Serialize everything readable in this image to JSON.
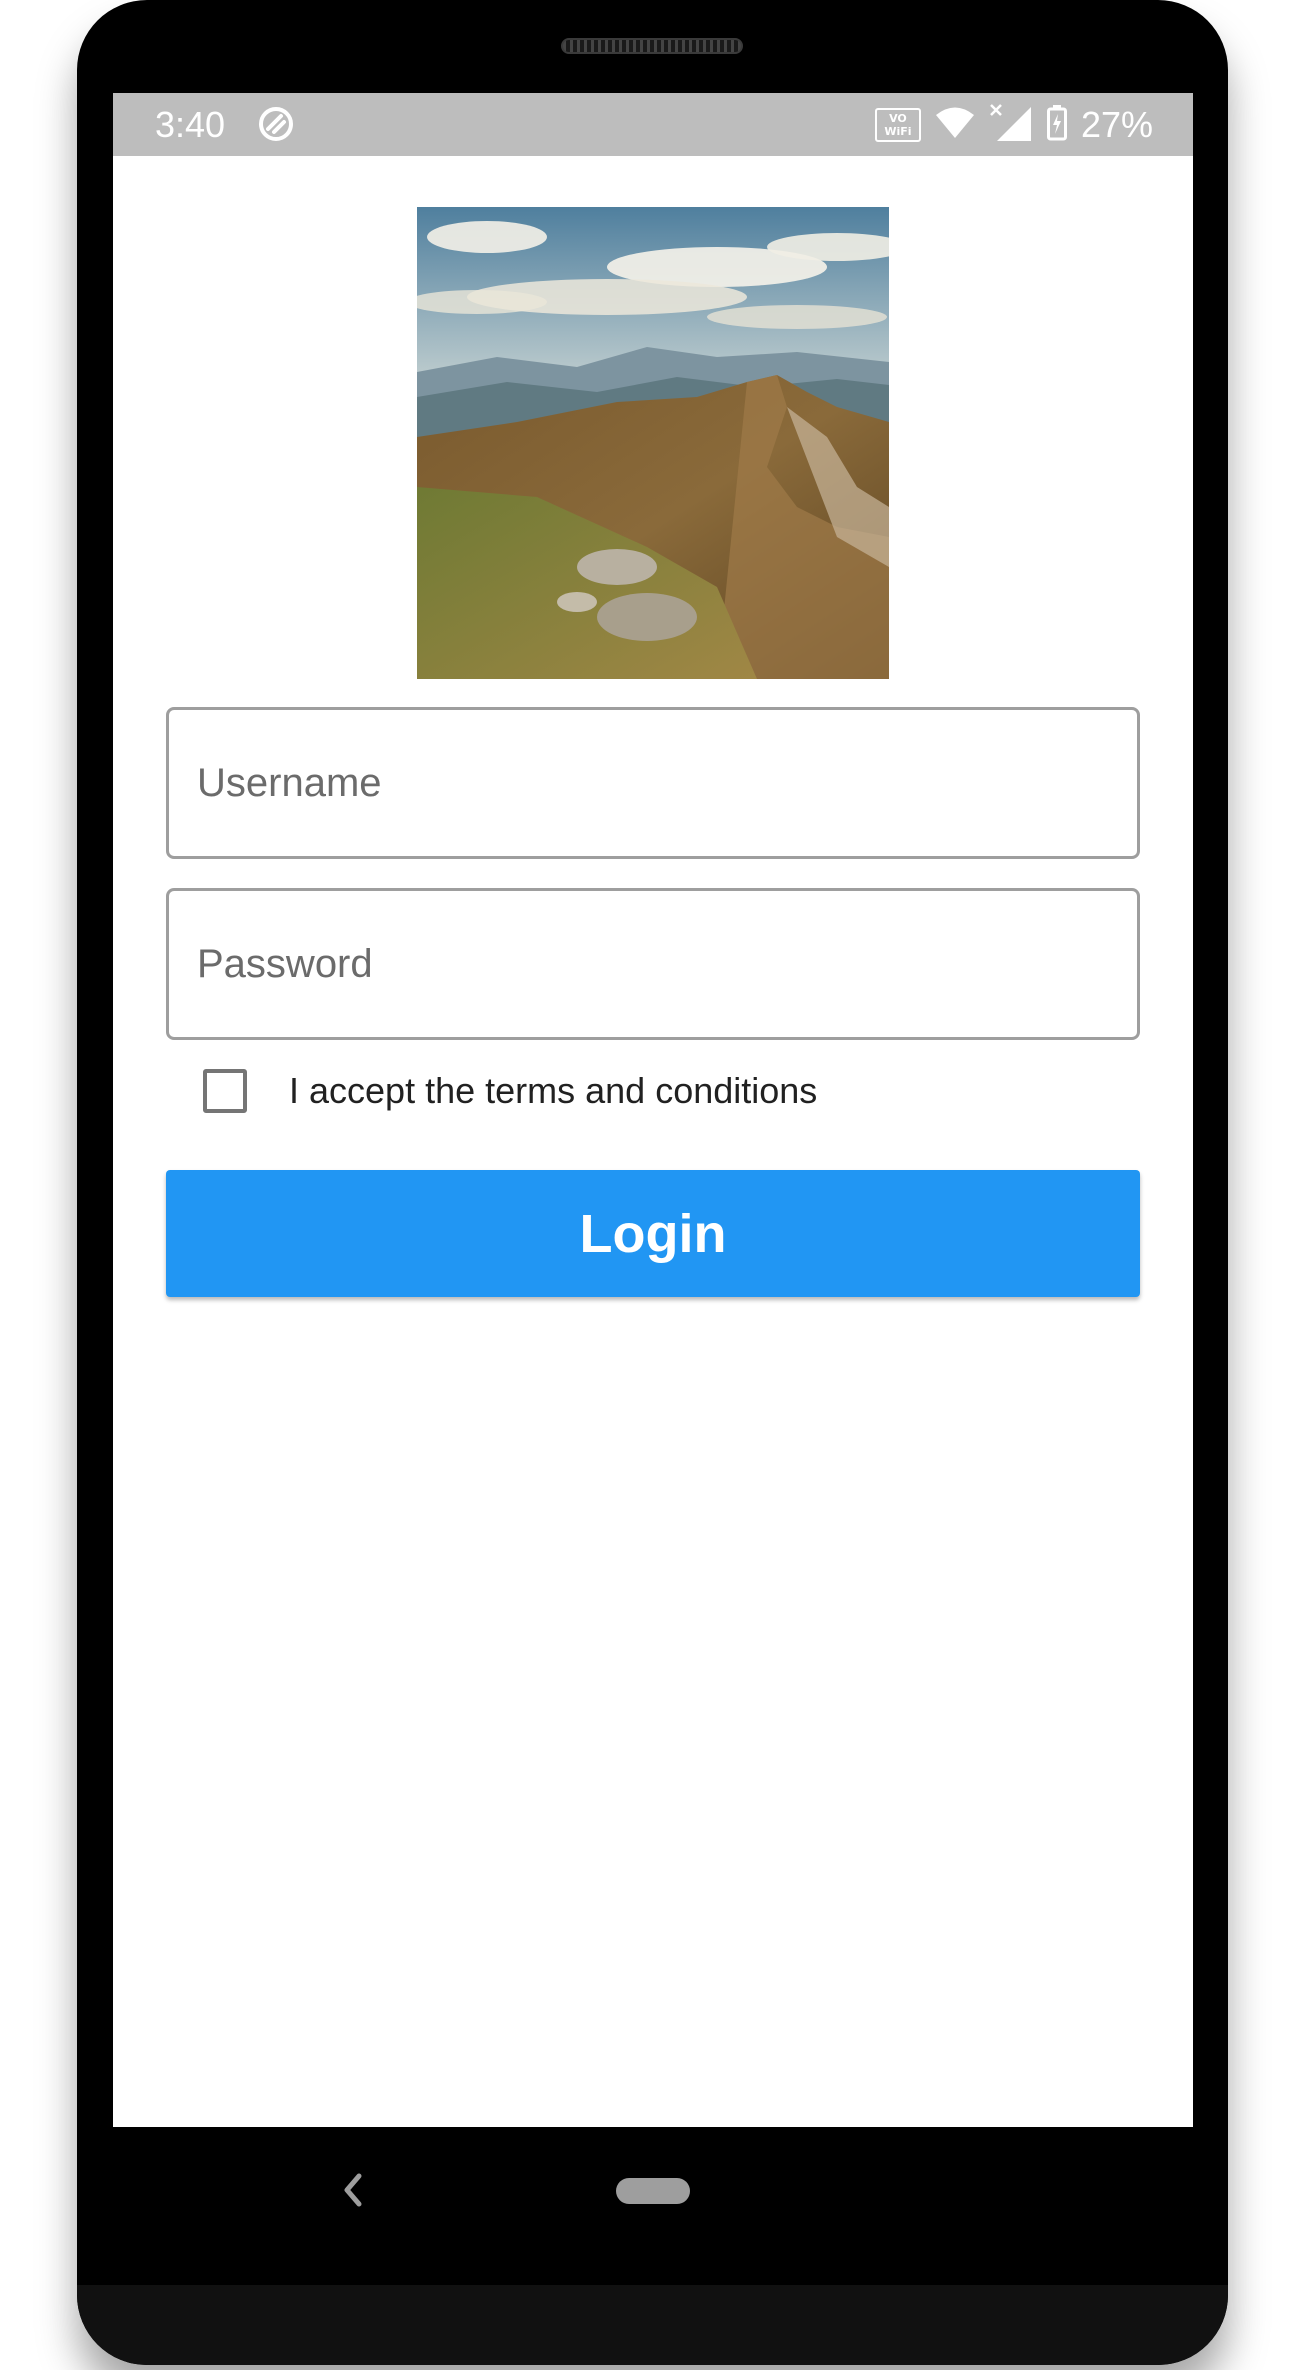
{
  "status_bar": {
    "time": "3:40",
    "vowifi_top": "VO",
    "vowifi_bottom": "WiFi",
    "battery_percent": "27%",
    "icons": [
      "app-notification-icon",
      "vowifi-icon",
      "wifi-icon",
      "no-sim-signal-icon",
      "battery-charging-icon"
    ]
  },
  "form": {
    "username_placeholder": "Username",
    "username_value": "",
    "password_placeholder": "Password",
    "password_value": "",
    "terms_label": "I accept the terms and conditions",
    "terms_checked": false,
    "login_label": "Login"
  },
  "colors": {
    "primary": "#2196f3",
    "status_bar": "#bdbdbd",
    "field_border": "#9e9e9e"
  },
  "nav_bar": {
    "icons": [
      "back-icon",
      "home-pill-icon"
    ]
  }
}
